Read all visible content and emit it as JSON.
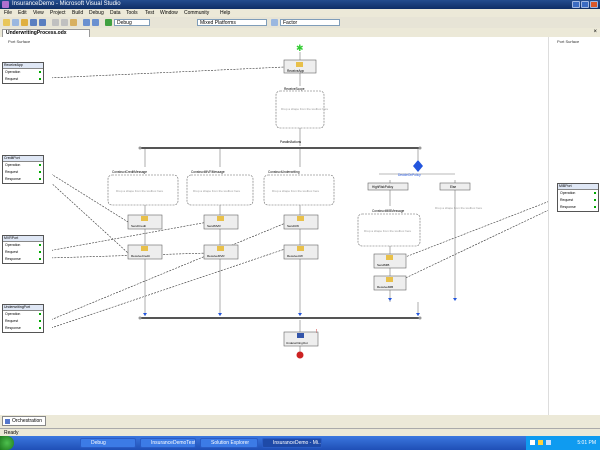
{
  "window": {
    "title": "InsuranceDemo - Microsoft Visual Studio"
  },
  "menu": [
    "File",
    "Edit",
    "View",
    "Project",
    "Build",
    "Debug",
    "Data",
    "Tools",
    "Test",
    "Window",
    "Community",
    "Help"
  ],
  "toolbar": {
    "config": "Debug",
    "platform": "Mixed Platforms",
    "search": "Factor"
  },
  "document_tab": {
    "label": "UnderwritingProcess.odx"
  },
  "panels": {
    "left_header": "Port Surface",
    "right_header": "Port Surface"
  },
  "ports": {
    "p1": {
      "name": "ReceiveApp",
      "op": "Operation",
      "rows": [
        "Request"
      ]
    },
    "p2": {
      "name": "CreditPort",
      "op": "Operation",
      "rows": [
        "Request",
        "Response"
      ]
    },
    "p3": {
      "name": "MVRPort",
      "op": "Operation",
      "rows": [
        "Request",
        "Response"
      ]
    },
    "p4": {
      "name": "UnderwritingPort",
      "op": "Operation",
      "rows": [
        "Request",
        "Response"
      ]
    },
    "p5": {
      "name": "MIBPort",
      "op": "Operation",
      "rows": [
        "Request",
        "Response"
      ]
    }
  },
  "shapes": {
    "receive": "ReceiveApp",
    "scope": "ReceiveScope",
    "drop1": "Drop a shape from the toolbox here",
    "parallel": "ParallelActions",
    "branch1": "ConstructCreditMessage",
    "branch2": "ConstructMVRMessage",
    "branch3": "ConstructUnderwriting",
    "decide": "DecideOnPolicy",
    "rule": "HighRiskPolicy",
    "else": "Else",
    "drop_else": "Drop a shape from the toolbox here",
    "construct": "ConstructMIBMessage",
    "drop_b1": "Drop a shape from the toolbox here",
    "drop_b2": "Drop a shape from the toolbox here",
    "drop_b3": "Drop a shape from the toolbox here",
    "drop_c": "Drop a shape from the toolbox here",
    "send1": "SendCredit",
    "recv1": "ReceiveCredit",
    "send2": "SendMVR",
    "recv2": "ReceiveMVR",
    "send3": "SendUW",
    "recv3": "ReceiveUW",
    "send4": "SendMIB",
    "recv4": "ReceiveMIB",
    "final_send": "UnderwritingOut"
  },
  "bottom_tab": "Orchestration",
  "status": "Ready",
  "taskbar": {
    "items": [
      "Debug",
      "InsuranceDemoTest",
      "Solution Explorer",
      "InsuranceDemo - Mi..."
    ],
    "clock": "5:01 PM"
  },
  "colors": {
    "accent": "#1f4fb6",
    "connector": "#333333",
    "shape_border": "#666666",
    "start": "#33cc33",
    "end": "#cc2222",
    "decision": "#2255dd"
  }
}
